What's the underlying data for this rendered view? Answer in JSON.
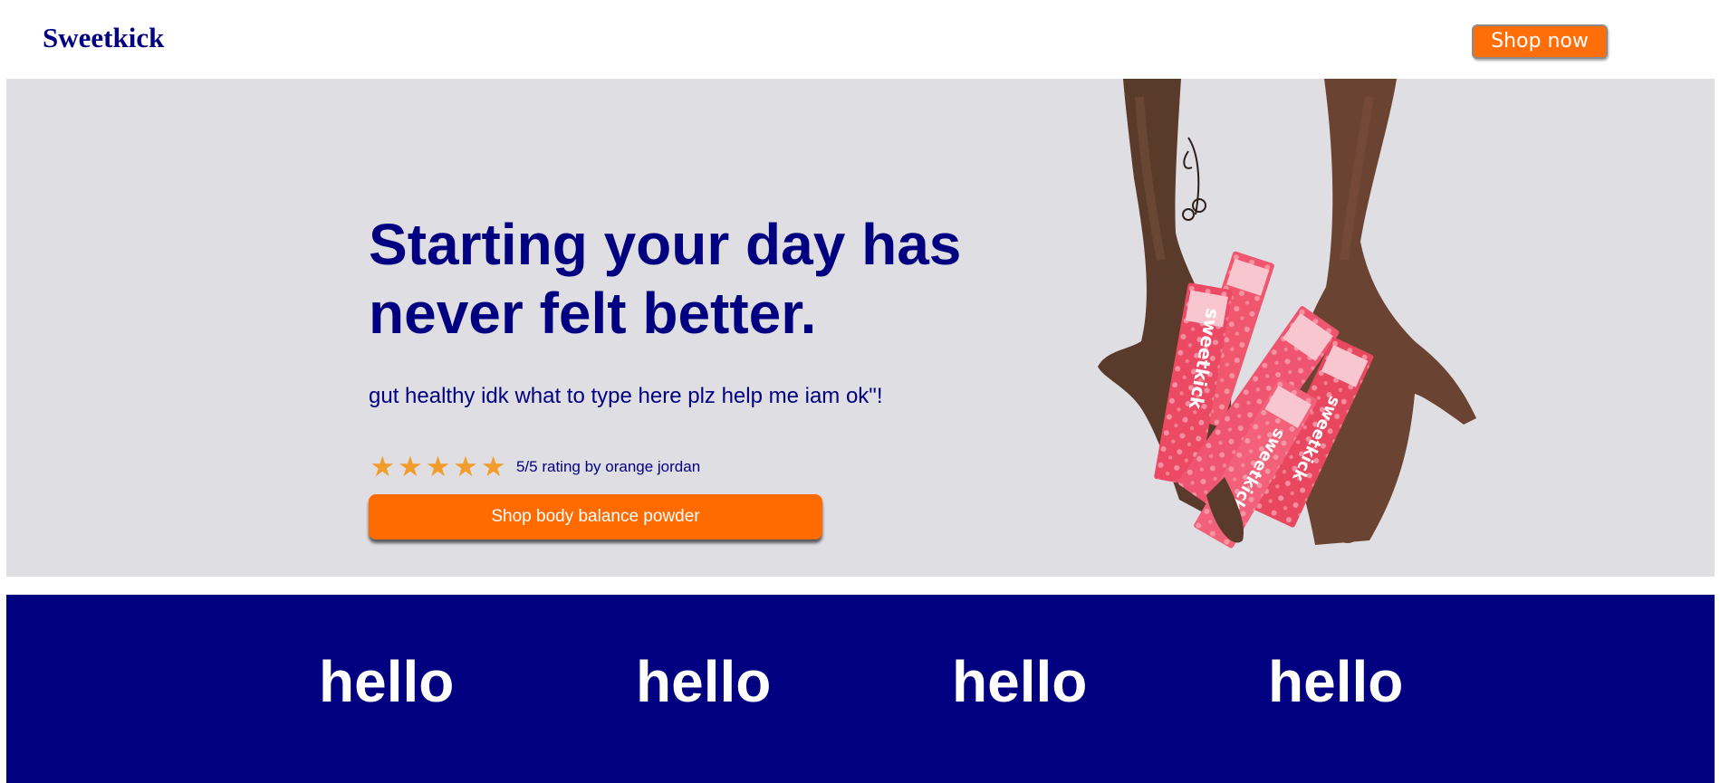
{
  "header": {
    "brand": "Sweetkick",
    "cta_label": "Shop now"
  },
  "hero": {
    "headline": "Starting your day has never felt better.",
    "subtext": "gut healthy idk what to type here plz help me iam ok\"!",
    "rating": {
      "stars": [
        "★",
        "★",
        "★",
        "★",
        "★"
      ],
      "value": 5,
      "max": 5,
      "text": "5/5 rating by orange jordan",
      "star_color": "#f29d2b"
    },
    "cta_label": "Shop body balance powder",
    "image": {
      "packet_brand": "sweetkick"
    }
  },
  "band": {
    "items": [
      "hello",
      "hello",
      "hello",
      "hello"
    ]
  },
  "colors": {
    "brand_navy": "#000080",
    "accent_orange": "#ff6b00",
    "hero_bg": "#dfdee3",
    "packet_pink": "#f0576f"
  }
}
